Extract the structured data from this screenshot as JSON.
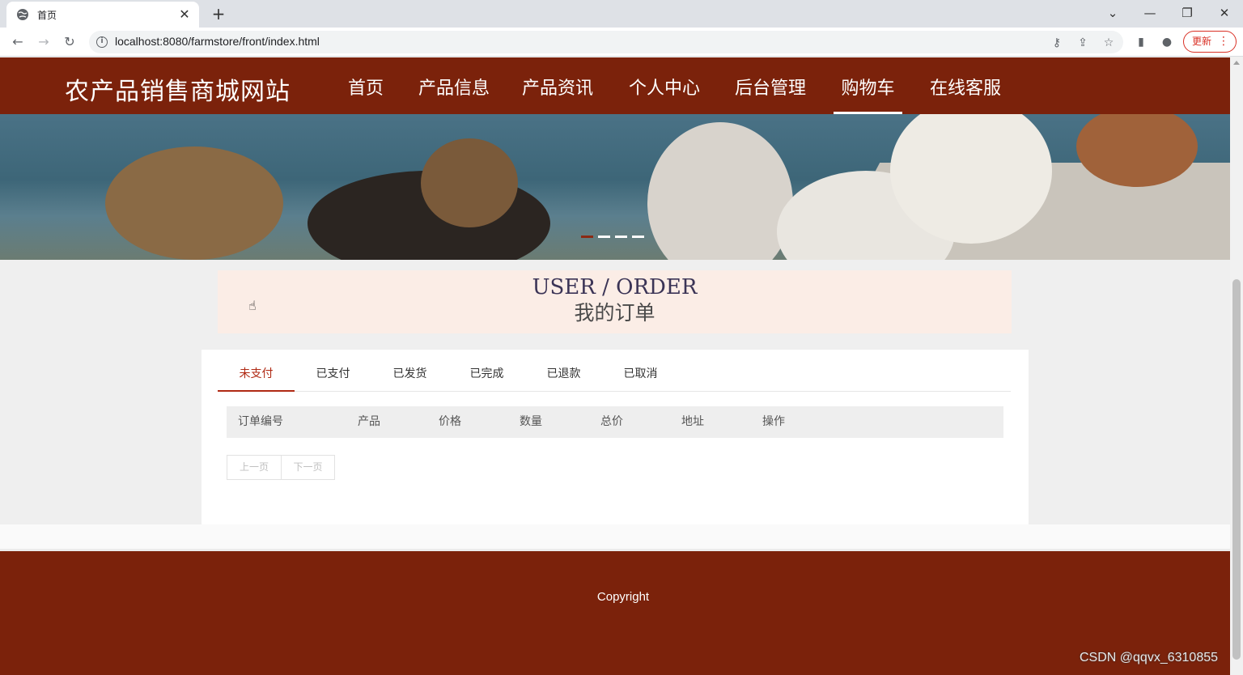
{
  "browser": {
    "tab_title": "首页",
    "url": "localhost:8080/farmstore/front/index.html",
    "update_label": "更新",
    "controls": {
      "minimize": "—",
      "restore": "❐",
      "close": "✕",
      "tab_list": "⌄"
    },
    "icons": [
      "globe-icon",
      "back-icon",
      "forward-icon",
      "reload-icon",
      "info-icon",
      "key-icon",
      "share-icon",
      "star-icon",
      "sidepanel-icon",
      "profile-icon",
      "menu-icon"
    ]
  },
  "header": {
    "site_title": "农产品销售商城网站",
    "nav": [
      {
        "label": "首页"
      },
      {
        "label": "产品信息"
      },
      {
        "label": "产品资讯"
      },
      {
        "label": "个人中心"
      },
      {
        "label": "后台管理"
      },
      {
        "label": "购物车",
        "active": true
      },
      {
        "label": "在线客服"
      }
    ]
  },
  "banner": {
    "active_slide": 1,
    "slide_count": 4,
    "colors": {
      "water": "#4a7286",
      "shore": "#c9c4bb"
    }
  },
  "order_section": {
    "title_en": "USER / ORDER",
    "title_cn": "我的订单"
  },
  "order_tabs": [
    {
      "label": "未支付",
      "active": true
    },
    {
      "label": "已支付"
    },
    {
      "label": "已发货"
    },
    {
      "label": "已完成"
    },
    {
      "label": "已退款"
    },
    {
      "label": "已取消"
    }
  ],
  "table": {
    "columns": [
      "订单编号",
      "产品",
      "价格",
      "数量",
      "总价",
      "地址",
      "操作"
    ],
    "rows": []
  },
  "pager": {
    "prev": "上一页",
    "next": "下一页"
  },
  "footer": {
    "copyright": "Copyright"
  },
  "watermark": "CSDN @qqvx_6310855",
  "colors": {
    "brand": "#7b220b",
    "accent": "#b02a14",
    "header_band": "#fbede6"
  }
}
